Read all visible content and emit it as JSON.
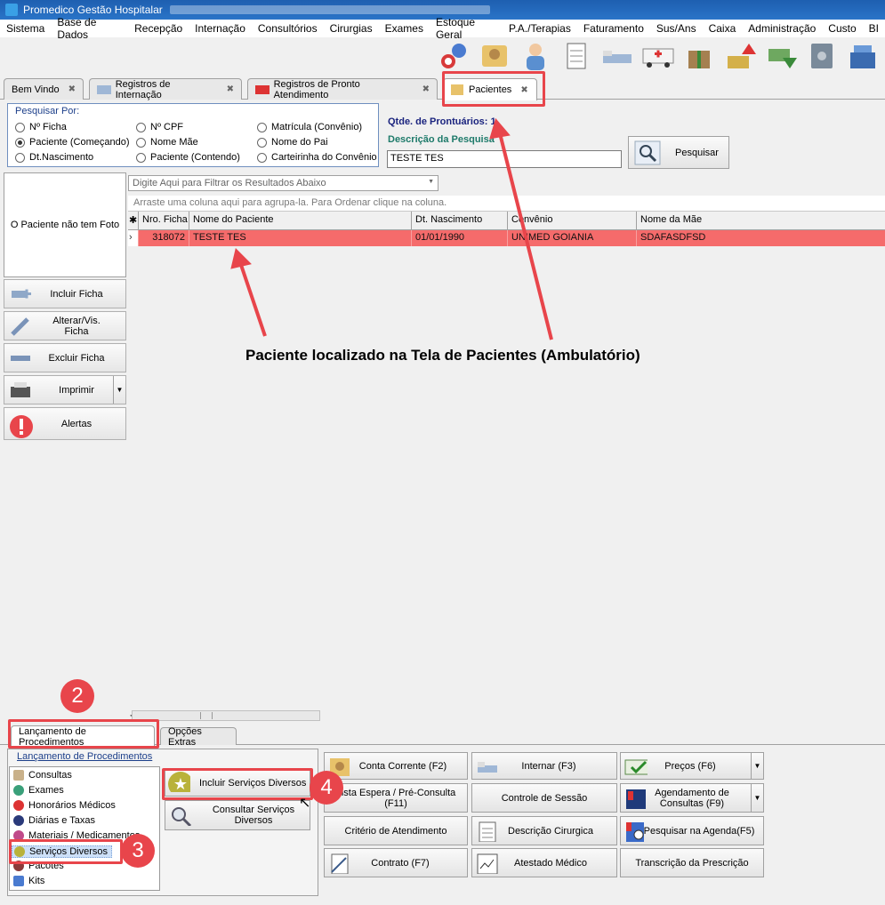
{
  "window": {
    "title": "Promedico Gestão Hospitalar"
  },
  "menu": [
    "Sistema",
    "Base de Dados",
    "Recepção",
    "Internação",
    "Consultórios",
    "Cirurgias",
    "Exames",
    "Estoque Geral",
    "P.A./Terapias",
    "Faturamento",
    "Sus/Ans",
    "Caixa",
    "Administração",
    "Custo",
    "BI"
  ],
  "toolbar": {
    "icons": [
      "refresh-patients-icon",
      "patient-card-icon",
      "doctor-icon",
      "notepad-icon",
      "bed-icon",
      "ambulance-icon",
      "gift-icon",
      "money-up-icon",
      "money-down-icon",
      "safe-icon",
      "cash-register-icon"
    ]
  },
  "tabs": [
    {
      "label": "Bem Vindo"
    },
    {
      "label": "Registros de Internação"
    },
    {
      "label": "Registros de Pronto Atendimento"
    },
    {
      "label": "Pacientes"
    }
  ],
  "search": {
    "legend": "Pesquisar Por:",
    "options": [
      "Nº Ficha",
      "Nº CPF",
      "Matrícula (Convênio)",
      "Paciente (Começando)",
      "Nome Mãe",
      "Nome do Pai",
      "Dt.Nascimento",
      "Paciente (Contendo)",
      "Carteirinha do Convênio"
    ],
    "selected": "Paciente (Começando)",
    "qtd_label": "Qtde. de Prontuários: 1",
    "desc_label": "Descrição da Pesquisa",
    "desc_value": "TESTE TES",
    "button": "Pesquisar"
  },
  "photo": {
    "text": "O Paciente não tem Foto"
  },
  "side_buttons": [
    "Incluir Ficha",
    "Alterar/Vis. Ficha",
    "Excluir Ficha",
    "Imprimir",
    "Alertas"
  ],
  "filter": {
    "placeholder": "Digite Aqui para Filtrar os Resultados Abaixo"
  },
  "group_hint": "Arraste uma coluna aqui para agrupa-la. Para Ordenar clique na coluna.",
  "grid": {
    "headers": [
      "Nro. Ficha",
      "Nome do Paciente",
      "Dt. Nascimento",
      "Convênio",
      "Nome da Mãe"
    ],
    "rows": [
      [
        "318072",
        "TESTE TES",
        "01/01/1990",
        "UNIMED GOIANIA",
        "SDAFASDFSD"
      ]
    ]
  },
  "annotation": "Paciente localizado na Tela de Pacientes (Ambulatório)",
  "bottom_tabs": [
    "Lançamento de Procedimentos",
    "Opções Extras"
  ],
  "procedures": {
    "legend": "Lançamento de Procedimentos",
    "items": [
      "Consultas",
      "Exames",
      "Honorários Médicos",
      "Diárias e Taxas",
      "Materiais / Medicamentos",
      "Serviços Diversos",
      "Pacotes",
      "Kits"
    ],
    "action_include": "Incluir Serviços Diversos",
    "action_consult": "Consultar Serviços Diversos"
  },
  "action_buttons": [
    "Conta Corrente (F2)",
    "Internar (F3)",
    "Preços (F6)",
    "Lista Espera / Pré-Consulta (F11)",
    "Controle de Sessão",
    "Agendamento de Consultas (F9)",
    "Critério de Atendimento",
    "Descrição Cirurgica",
    "Pesquisar na Agenda(F5)",
    "Contrato (F7)",
    "Atestado Médico",
    "Transcrição da Prescrição"
  ],
  "badges": [
    "2",
    "3",
    "4"
  ],
  "colors": {
    "highlight_row": "#f56b6b",
    "annotation_red": "#e8454b",
    "title_blue": "#2a74c8"
  }
}
